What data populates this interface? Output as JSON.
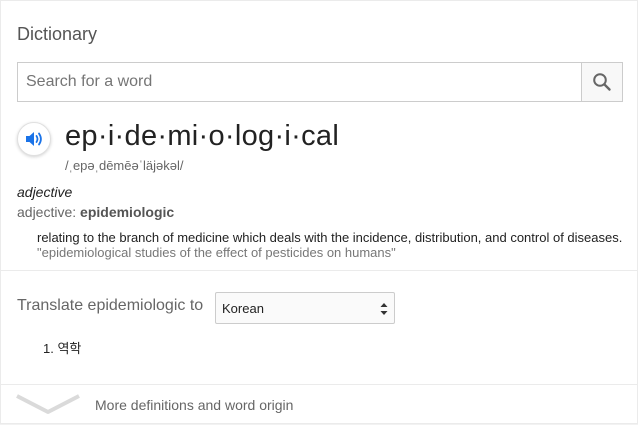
{
  "panel": {
    "title": "Dictionary"
  },
  "search": {
    "placeholder": "Search for a word",
    "value": ""
  },
  "entry": {
    "word": "ep·i·de·mi·o·log·i·cal",
    "phonetic": "/ˌepəˌdēmēəˈläjəkəl/",
    "part_of_speech": "adjective",
    "alt_form_prefix": "adjective: ",
    "alt_form_word": "epidemiologic",
    "definition": "relating to the branch of medicine which deals with the incidence, distribution, and control of diseases.",
    "example": "\"epidemiological studies of the effect of pesticides on humans\""
  },
  "translate": {
    "label": "Translate epidemiologic to",
    "language": "Korean",
    "results": [
      {
        "number": "1.",
        "text": "역학"
      }
    ]
  },
  "footer": {
    "more_label": "More definitions and word origin"
  },
  "icons": {
    "search": "search-icon",
    "audio": "speaker-icon",
    "expand": "chevron-down-icon",
    "select": "select-arrows-icon"
  },
  "colors": {
    "accent": "#1a73e8",
    "text": "#222222",
    "muted": "#666666"
  }
}
